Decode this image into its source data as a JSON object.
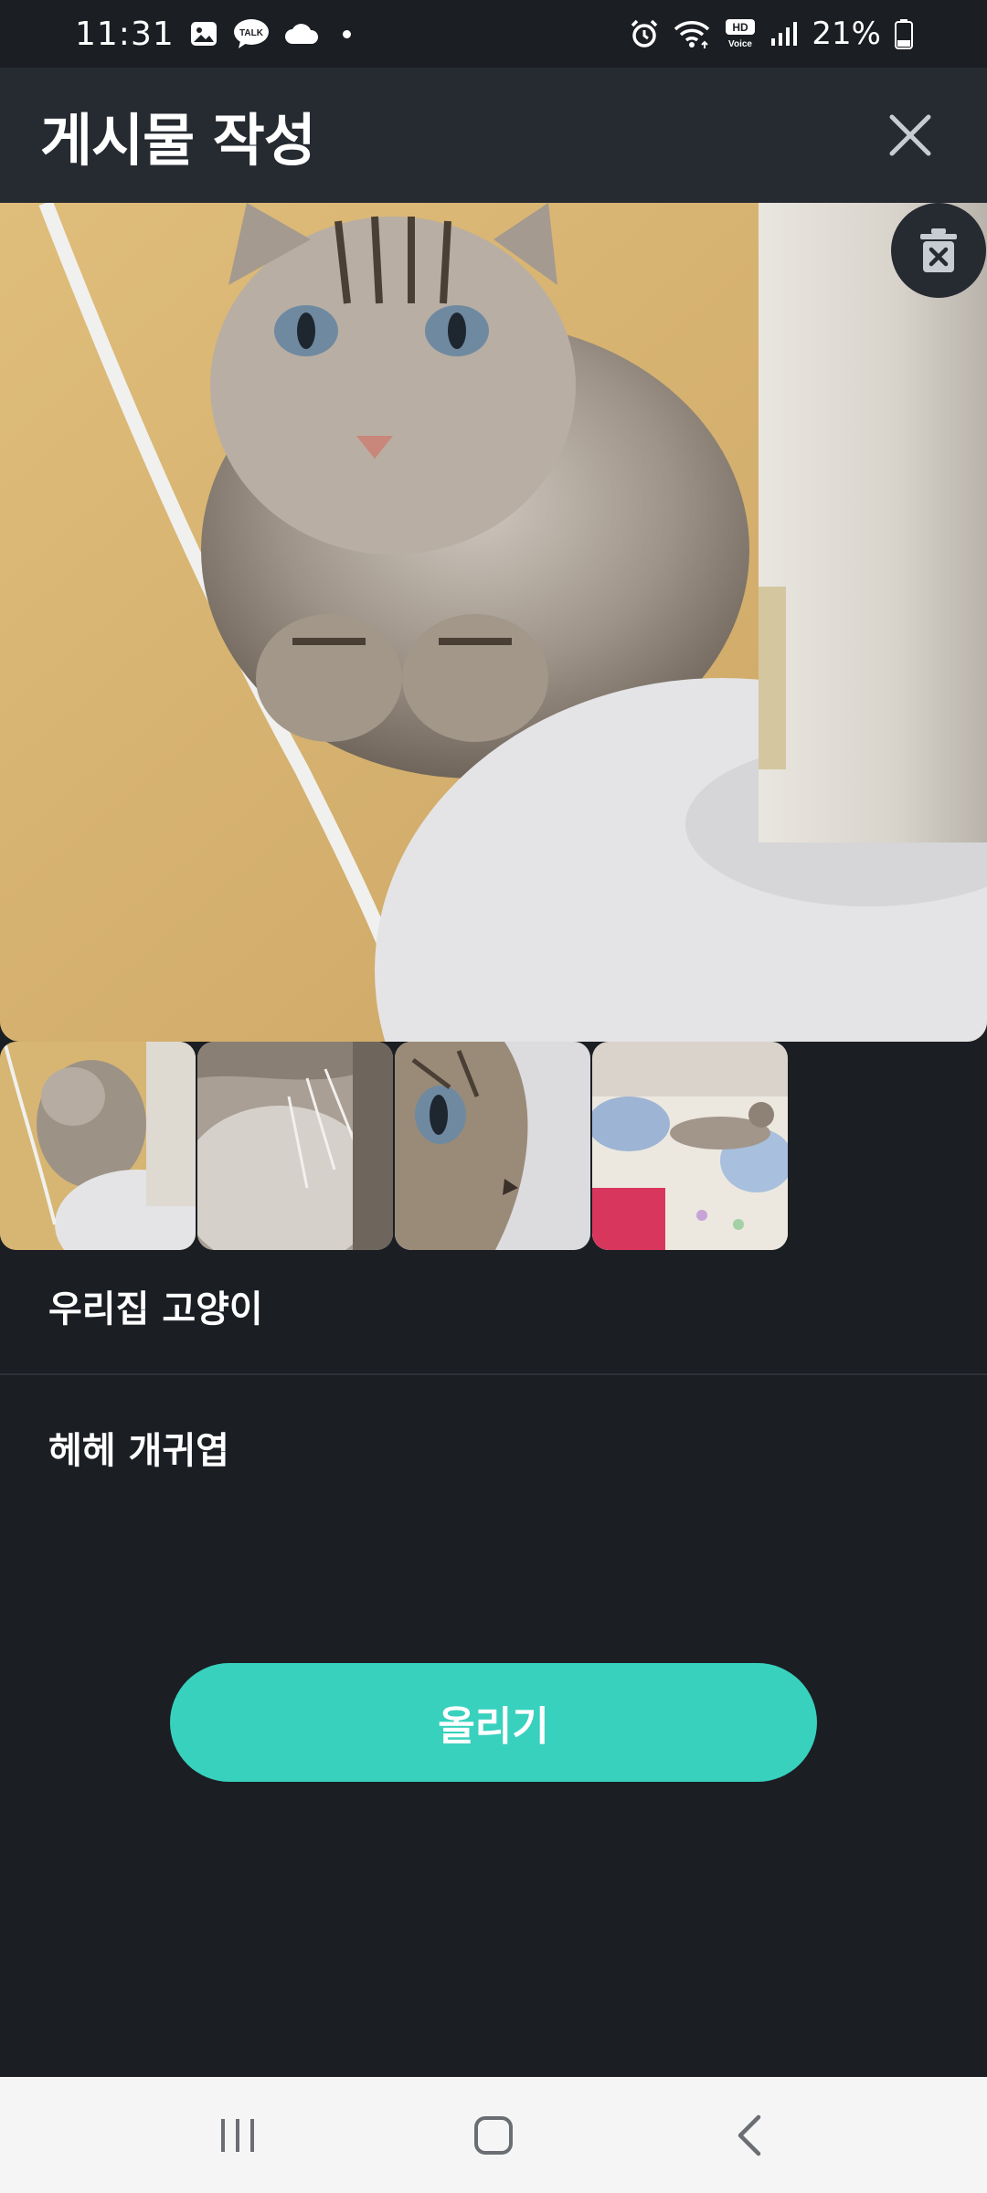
{
  "status_bar": {
    "time": "11:31",
    "left_icons": [
      "gallery-icon",
      "kakaotalk-icon",
      "cloud-icon",
      "notification-dot"
    ],
    "talk_badge": "TALK",
    "hd_badge": "HD",
    "voice_badge": "Voice",
    "right_icons": [
      "alarm-icon",
      "wifi-icon",
      "hd-voice-icon",
      "signal-icon",
      "battery-icon"
    ],
    "battery": "21%"
  },
  "header": {
    "title": "게시물 작성",
    "close_icon": "close-icon"
  },
  "media": {
    "main_photo": "cat-photo",
    "delete_icon": "trash-icon",
    "thumbnails": [
      "cat-by-fan",
      "cat-fur-closeup",
      "cat-eye-closeup",
      "cat-on-bed"
    ]
  },
  "form": {
    "title_value": "우리집 고양이",
    "body_value": "헤헤 개귀엽"
  },
  "actions": {
    "upload_label": "올리기"
  },
  "colors": {
    "background": "#1b1e23",
    "header": "#262a31",
    "accent": "#38d1be"
  },
  "nav": {
    "buttons": [
      "recent-apps-icon",
      "home-icon",
      "back-icon"
    ]
  }
}
